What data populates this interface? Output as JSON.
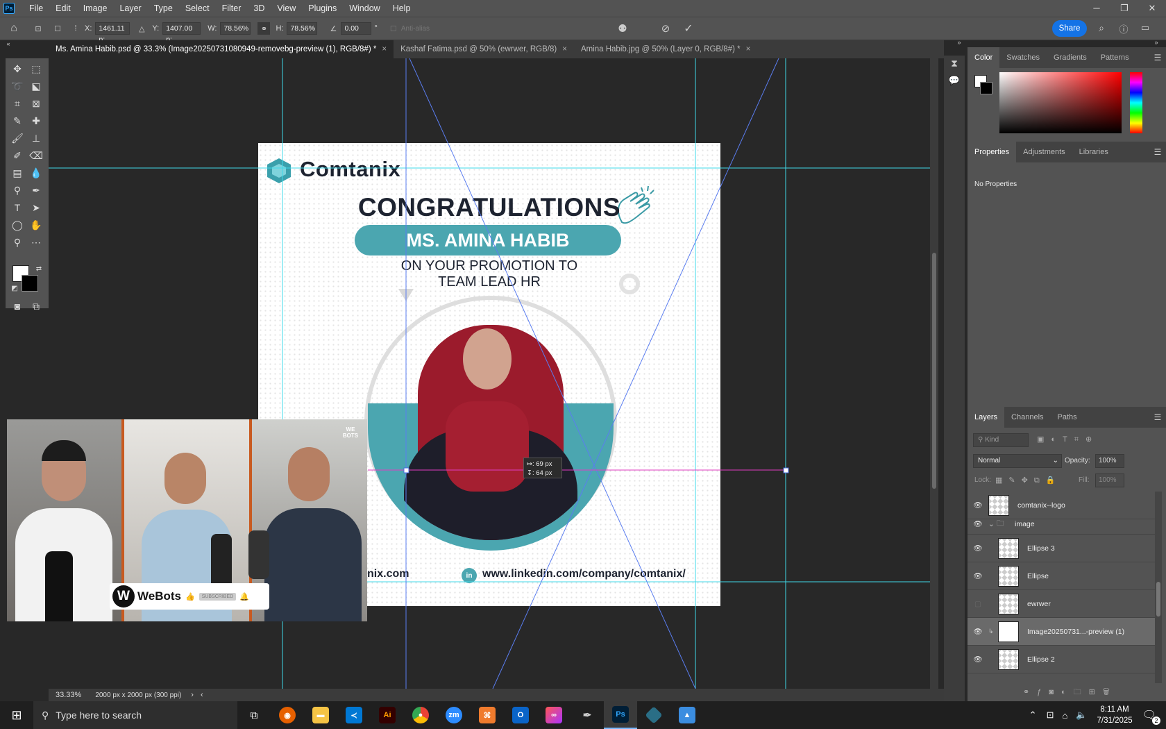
{
  "app": {
    "logo": "Ps",
    "menu": [
      "File",
      "Edit",
      "Image",
      "Layer",
      "Type",
      "Select",
      "Filter",
      "3D",
      "View",
      "Plugins",
      "Window",
      "Help"
    ],
    "window_controls": [
      "minimize-icon",
      "restore-icon",
      "close-icon"
    ]
  },
  "options": {
    "x_label": "X:",
    "x_value": "1461.11 p:",
    "y_label": "Y:",
    "y_value": "1407.00 p:",
    "w_label": "W:",
    "w_value": "78.56%",
    "h_label": "H:",
    "h_value": "78.56%",
    "angle_value": "0.00",
    "angle_unit": "°",
    "antialias": "Anti-alias",
    "share": "Share"
  },
  "tabs": [
    {
      "label": "Ms. Amina Habib.psd @ 33.3% (Image20250731080949-removebg-preview (1), RGB/8#) *",
      "active": true
    },
    {
      "label": "Kashaf Fatima.psd @ 50% (ewrwer, RGB/8)",
      "active": false
    },
    {
      "label": "Amina Habib.jpg @ 50% (Layer 0, RGB/8#) *",
      "active": false
    }
  ],
  "canvas": {
    "brand": "Comtanix",
    "headline": "CONGRATULATIONS",
    "name": "MS. AMINA HABIB",
    "line1": "ON YOUR PROMOTION TO",
    "line2": "TEAM LEAD HR",
    "website_partial": "nix.com",
    "linkedin": "www.linkedin.com/company/comtanix/",
    "measure1": "↦: 69 px",
    "measure2": "↧: 64 px",
    "accent": "#4ba6b0"
  },
  "video": {
    "channel": "WeBots",
    "subscribe": "SUBSCRIBED",
    "badge": "WE BOTS"
  },
  "color_panel": {
    "tabs": [
      "Color",
      "Swatches",
      "Gradients",
      "Patterns"
    ]
  },
  "properties_panel": {
    "tabs": [
      "Properties",
      "Adjustments",
      "Libraries"
    ],
    "content": "No Properties"
  },
  "layers_panel": {
    "tabs": [
      "Layers",
      "Channels",
      "Paths"
    ],
    "kind": "Kind",
    "blend": "Normal",
    "opacity_label": "Opacity:",
    "opacity": "100%",
    "lock_label": "Lock:",
    "fill_label": "Fill:",
    "fill": "100%",
    "layers": [
      {
        "name": "comtanix--logo",
        "visible": true
      },
      {
        "name": "image",
        "visible": true
      },
      {
        "name": "Ellipse 3",
        "visible": true
      },
      {
        "name": "Ellipse",
        "visible": true
      },
      {
        "name": "ewrwer",
        "visible": false
      },
      {
        "name": "Image20250731...-preview (1)",
        "visible": true
      },
      {
        "name": "Ellipse 2",
        "visible": true
      }
    ]
  },
  "status": {
    "zoom": "33.33%",
    "doc": "2000 px x 2000 px (300 ppi)"
  },
  "taskbar": {
    "search": "Type here to search",
    "time": "8:11 AM",
    "date": "7/31/2025",
    "notif": "2"
  }
}
